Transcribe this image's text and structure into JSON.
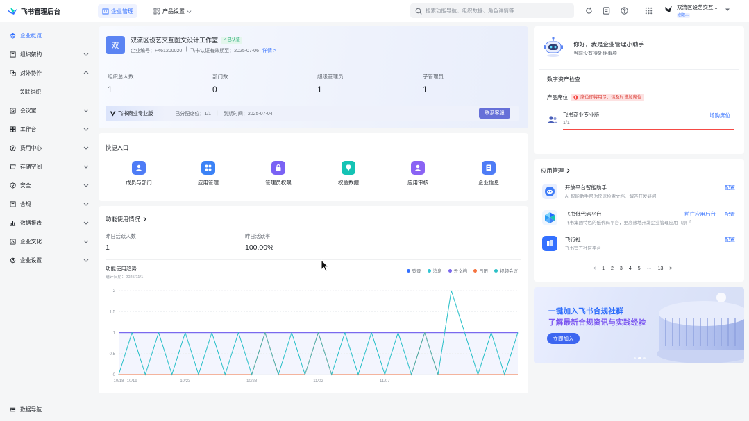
{
  "app": {
    "title": "飞书管理后台"
  },
  "topnav": {
    "tabs": [
      {
        "label": "企业管理"
      },
      {
        "label": "产品设置"
      }
    ],
    "search_placeholder": "搜索功能导航、组织数据、角色详情等",
    "org_name": "双流区设艺交互...",
    "org_badge": "创建人"
  },
  "sidebar": {
    "items": [
      {
        "label": "企业概览"
      },
      {
        "label": "组织架构"
      },
      {
        "label": "对外协作"
      },
      {
        "label": "关联组织"
      },
      {
        "label": "会议室"
      },
      {
        "label": "工作台"
      },
      {
        "label": "费用中心"
      },
      {
        "label": "存储空间"
      },
      {
        "label": "安全"
      },
      {
        "label": "合规"
      },
      {
        "label": "数据报表"
      },
      {
        "label": "企业文化"
      },
      {
        "label": "企业设置"
      }
    ],
    "footer_label": "数据导航"
  },
  "org": {
    "avatar_char": "双",
    "name": "双流区设艺交互图文设计工作室",
    "verified": "已认证",
    "enterprise_id": "企业编号：F461200020",
    "cert_expire": "飞书认证有效期至：2025-07-06",
    "details_link": "详情 >",
    "stats": [
      {
        "label": "组织总人数",
        "value": "1"
      },
      {
        "label": "部门数",
        "value": "0"
      },
      {
        "label": "超级管理员",
        "value": "1"
      },
      {
        "label": "子管理员",
        "value": "1"
      }
    ],
    "plan": {
      "name": "飞书商业专业版",
      "seats": "已分配席位：1/1",
      "expire": "到期时间：2025-07-04",
      "contact": "联系客服"
    }
  },
  "quick_entry": {
    "title": "快捷入口",
    "items": [
      {
        "label": "成员与部门",
        "color": "#4e7cf6"
      },
      {
        "label": "应用管理",
        "color": "#3b82f6"
      },
      {
        "label": "管理员权限",
        "color": "#7a62f4"
      },
      {
        "label": "权益数据",
        "color": "#14c3b4"
      },
      {
        "label": "应用审核",
        "color": "#8a63f4"
      },
      {
        "label": "企业信息",
        "color": "#4e7cf6"
      }
    ]
  },
  "function_usage": {
    "title": "功能使用情况",
    "stats": [
      {
        "label": "昨日活跃人数",
        "value": "1"
      },
      {
        "label": "昨日活跃率",
        "value": "100.00%"
      }
    ],
    "trend_title": "功能使用趋势",
    "trend_subtitle": "统计日期：2025/11/1",
    "legend": [
      {
        "name": "登录",
        "color": "#3370ff"
      },
      {
        "name": "消息",
        "color": "#34c5d3"
      },
      {
        "name": "云文档",
        "color": "#7b68ee"
      },
      {
        "name": "日历",
        "color": "#f5733f"
      },
      {
        "name": "视频会议",
        "color": "#2bc0c6"
      }
    ]
  },
  "chart_data": {
    "type": "line",
    "x": [
      "10/18",
      "10/19",
      "10/20",
      "10/21",
      "10/22",
      "10/23",
      "10/24",
      "10/25",
      "10/26",
      "10/27",
      "10/28",
      "10/29",
      "10/30",
      "10/31",
      "11/01",
      "11/02",
      "11/03",
      "11/04",
      "11/05",
      "11/06",
      "11/07",
      "11/08",
      "11/09",
      "11/10",
      "11/11",
      "11/12",
      "11/13",
      "11/14",
      "11/15",
      "11/16",
      "11/17"
    ],
    "x_tick_labels": [
      "10/18",
      "10/19",
      "10/23",
      "10/28",
      "11/02",
      "11/07"
    ],
    "y_ticks": [
      "2",
      "1.5",
      "1",
      "0.5",
      "0"
    ],
    "ylim": [
      0,
      2
    ],
    "series": [
      {
        "name": "登录",
        "color": "#3370ff",
        "values": [
          1,
          1,
          1,
          1,
          1,
          1,
          1,
          1,
          1,
          1,
          1,
          1,
          1,
          1,
          1,
          1,
          1,
          1,
          1,
          1,
          1,
          1,
          1,
          1,
          1,
          1,
          1,
          1,
          1,
          1,
          1
        ]
      },
      {
        "name": "消息",
        "color": "#34c5d3",
        "values": [
          0,
          1,
          0,
          1,
          0,
          1,
          0,
          1,
          0,
          1,
          0,
          1,
          0,
          1,
          0,
          1,
          0,
          1,
          0,
          1,
          0,
          1,
          0,
          1,
          0,
          2,
          1,
          0,
          1,
          0,
          1
        ]
      },
      {
        "name": "云文档",
        "color": "#7b68ee",
        "values": [
          1,
          1,
          1,
          1,
          1,
          1,
          1,
          1,
          1,
          1,
          1,
          1,
          1,
          1,
          1,
          1,
          1,
          1,
          1,
          1,
          1,
          1,
          1,
          1,
          1,
          1,
          1,
          1,
          1,
          1,
          1
        ]
      },
      {
        "name": "日历",
        "color": "#f5733f",
        "values": [
          0,
          0,
          0,
          0,
          0,
          0,
          0,
          0,
          0,
          0,
          0,
          1,
          0,
          0,
          0,
          1,
          0,
          0,
          0,
          0,
          0,
          0,
          0,
          1,
          0,
          0,
          0,
          0,
          0,
          0,
          0
        ]
      },
      {
        "name": "视频会议",
        "color": "#2bc0c6",
        "values": [
          0,
          1,
          0,
          1,
          0,
          1,
          0,
          1,
          0,
          1,
          0,
          1,
          0,
          1,
          0,
          1,
          0,
          1,
          0,
          1,
          0,
          1,
          0,
          1,
          0,
          2,
          1,
          0,
          1,
          0,
          1
        ]
      }
    ]
  },
  "assistant": {
    "title": "你好，我是企业管理小助手",
    "subtitle": "当前没有待处理事项",
    "assets_title": "数字资产检查",
    "seat_label": "产品席位",
    "seat_warning": "席位即将用尽，请及时增加席位",
    "plan_name": "飞书商业专业版",
    "plan_count": "1/1",
    "add_seats": "增购席位",
    "usage_fraction": 1.0
  },
  "apps": {
    "title": "应用管理",
    "items": [
      {
        "name": "开放平台智能助手",
        "desc": "AI 智能助手帮你快速检索文档、解答开发疑问",
        "action": "配置",
        "extra": ""
      },
      {
        "name": "飞书低代码平台",
        "desc": "飞书集团特色的低代码平台，更高效地开发企业管理应用（原「飞书…",
        "action": "配置",
        "extra": "前往应用后台"
      },
      {
        "name": "飞行社",
        "desc": "飞书官方社区平台",
        "action": "配置",
        "extra": ""
      }
    ],
    "pager": [
      "<",
      "1",
      "2",
      "3",
      "4",
      "5",
      "···",
      "13",
      ">"
    ]
  },
  "banner": {
    "line1": "一键加入飞书合规社群",
    "line2": "了解最新合规资讯与实践经验",
    "cta": "立即加入"
  }
}
